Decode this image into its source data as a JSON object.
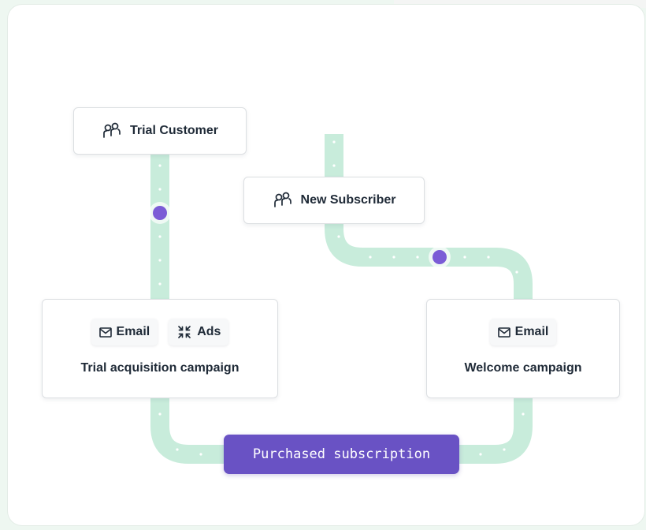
{
  "nodes": {
    "trial_customer": {
      "label": "Trial Customer",
      "icon": "people-icon"
    },
    "new_subscriber": {
      "label": "New Subscriber",
      "icon": "people-icon"
    }
  },
  "campaigns": {
    "trial": {
      "title": "Trial acquisition campaign",
      "channels": [
        {
          "label": "Email",
          "icon": "email-icon"
        },
        {
          "label": "Ads",
          "icon": "ads-icon"
        }
      ]
    },
    "welcome": {
      "title": "Welcome campaign",
      "channels": [
        {
          "label": "Email",
          "icon": "email-icon"
        }
      ]
    }
  },
  "outcome": {
    "label": "Purchased subscription"
  },
  "colors": {
    "path": "#c8ecdb",
    "path_dot": "#ffffff",
    "marker": "#7b5cd6",
    "outcome": "#6952c4",
    "text": "#1f2a37"
  }
}
